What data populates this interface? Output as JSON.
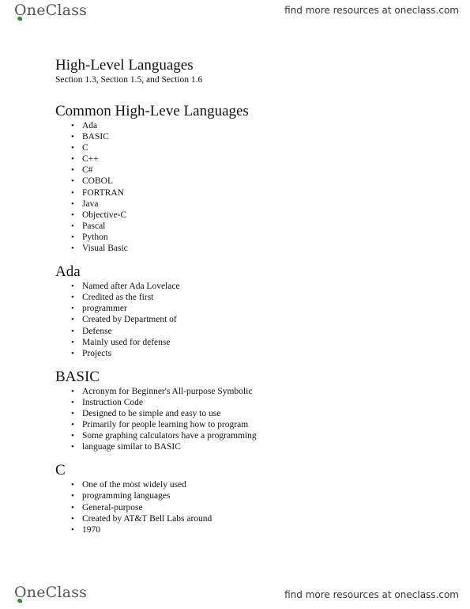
{
  "header": {
    "brand": "OneClass",
    "tagline": "find more resources at oneclass.com"
  },
  "footer": {
    "brand": "OneClass",
    "tagline": "find more resources at oneclass.com"
  },
  "document": {
    "title": "High-Level Languages",
    "subtitle": "Section 1.3, Section 1.5, and Section 1.6",
    "sections": [
      {
        "heading": "Common High-Leve Languages",
        "items": [
          "Ada",
          "BASIC",
          "C",
          "C++",
          "C#",
          "COBOL",
          "FORTRAN",
          "Java",
          "Objective-C",
          "Pascal",
          "Python",
          "Visual Basic"
        ]
      },
      {
        "heading": "Ada",
        "items": [
          "Named after Ada Lovelace",
          "Credited as the first",
          "programmer",
          "Created by Department of",
          "Defense",
          "Mainly used for defense",
          "Projects"
        ]
      },
      {
        "heading": "BASIC",
        "items": [
          "Acronym for Beginner's All-purpose Symbolic",
          "Instruction Code",
          "Designed to be simple and easy to use",
          "Primarily for people learning how to program",
          "Some graphing calculators have a programming",
          "language similar to BASIC"
        ]
      },
      {
        "heading": "C",
        "items": [
          "One of the most widely used",
          "programming languages",
          "General-purpose",
          "Created by AT&T Bell Labs around",
          "1970"
        ]
      }
    ]
  }
}
